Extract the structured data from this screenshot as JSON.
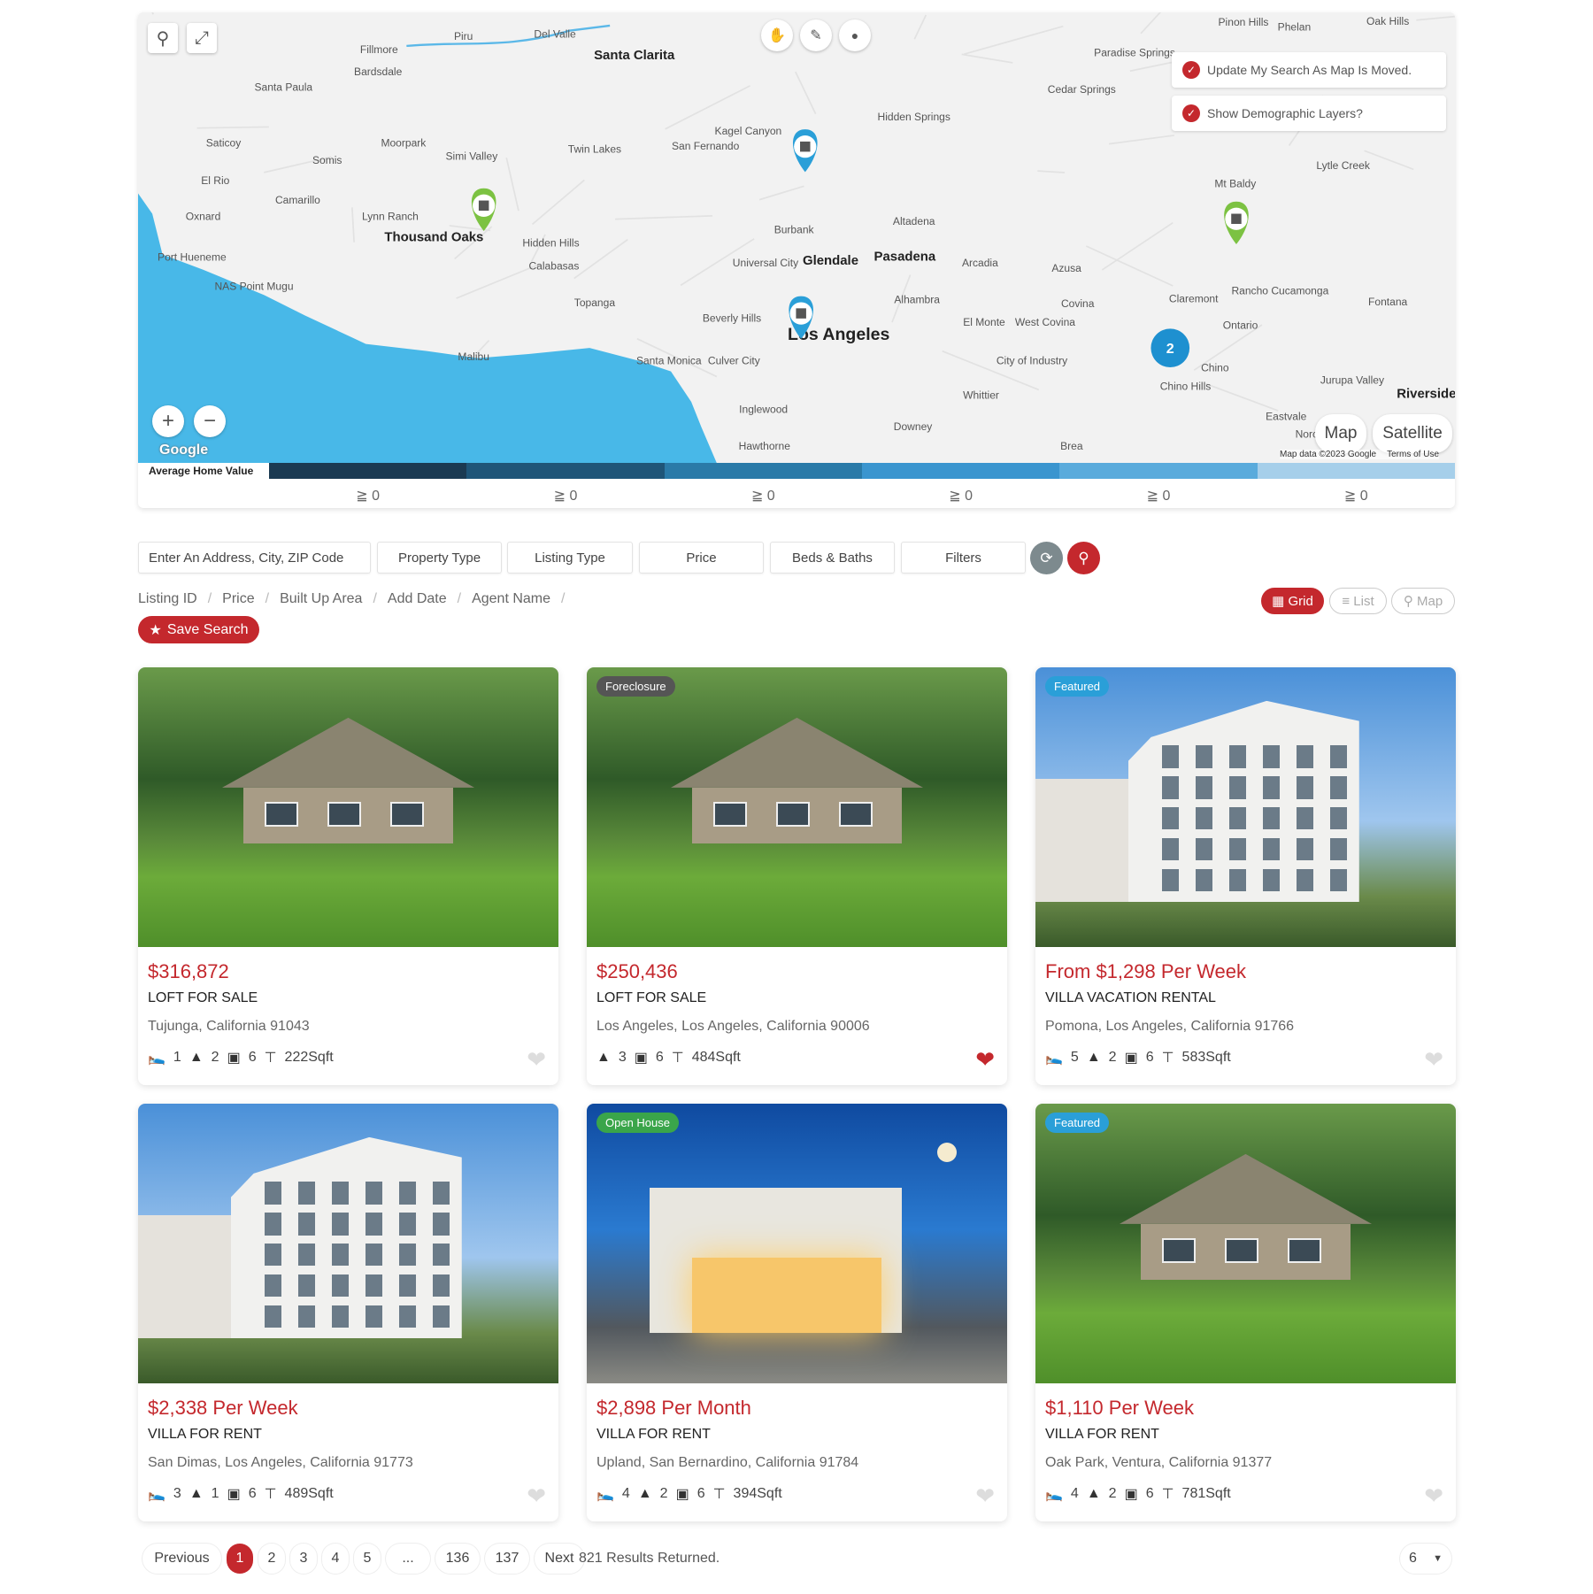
{
  "map": {
    "labels": [
      "Santa Clarita",
      "Thousand Oaks",
      "Glendale",
      "Pasadena",
      "Los Angeles",
      "Santa Monica",
      "Culver City",
      "Beverly Hills",
      "Burbank",
      "Malibu",
      "Topanga",
      "Calabasas",
      "Hidden Hills",
      "Simi Valley",
      "Moorpark",
      "Camarillo",
      "Oxnard",
      "Port Hueneme",
      "Somis",
      "Fillmore",
      "Santa Paula",
      "Piru",
      "Del Valle",
      "Twin Lakes",
      "San Fernando",
      "Kagel Canyon",
      "Altadena",
      "Arcadia",
      "Azusa",
      "Covina",
      "West Covina",
      "El Monte",
      "Alhambra",
      "Whittier",
      "Inglewood",
      "Hawthorne",
      "Downey",
      "Brea",
      "Claremont",
      "Ontario",
      "Rancho Cucamonga",
      "Fontana",
      "Chino",
      "Chino Hills",
      "Jurupa Valley",
      "Riverside",
      "Eastvale",
      "Mt Baldy",
      "Lytle Creek",
      "Cedar Springs",
      "Paradise Springs",
      "Pinon Hills",
      "Phelan",
      "Oak Hills",
      "Hidden Springs",
      "City of Industry",
      "Universal City",
      "Lynn Ranch",
      "Saticoy",
      "El Rio",
      "NAS Point Mugu",
      "Bardsdale",
      "Norco"
    ],
    "cluster_count": "2",
    "update_search_label": "Update My Search As Map Is Moved.",
    "demographic_label": "Show Demographic Layers?",
    "map_type_map": "Map",
    "map_type_satellite": "Satellite",
    "google_logo": "Google",
    "attribution": "Map data ©2023 Google",
    "terms": "Terms of Use",
    "zoom_in": "+",
    "zoom_out": "−",
    "ocean_color": "#48b8e8",
    "land_color": "#f2f2f2"
  },
  "legend": {
    "title": "Average Home Value",
    "colors": [
      "#1b3a52",
      "#1f5578",
      "#2a7aa8",
      "#3a95cf",
      "#5aabdc",
      "#a6cfea"
    ],
    "values": [
      "≧ 0",
      "≧ 0",
      "≧ 0",
      "≧ 0",
      "≧ 0",
      "≧ 0"
    ]
  },
  "filters": {
    "address_placeholder": "Enter An Address, City, ZIP Code",
    "property_type": "Property Type",
    "listing_type": "Listing Type",
    "price": "Price",
    "beds_baths": "Beds & Baths",
    "filters": "Filters"
  },
  "sort": [
    "Listing ID",
    "Price",
    "Built Up Area",
    "Add Date",
    "Agent Name"
  ],
  "views": {
    "grid": "Grid",
    "list": "List",
    "map": "Map",
    "active": "grid"
  },
  "save_search": "Save Search",
  "accent": "#c4282d",
  "listings": [
    {
      "image": "house",
      "badge": "",
      "price": "$316,872",
      "type": "LOFT FOR SALE",
      "address": "Tujunga, California 91043",
      "beds": "1",
      "baths": "2",
      "garage": "6",
      "area": "222Sqft",
      "favorite": false
    },
    {
      "image": "house",
      "badge": "Foreclosure",
      "badge_color": "#555555",
      "price": "$250,436",
      "type": "LOFT FOR SALE",
      "address": "Los Angeles, Los Angeles, California 90006",
      "baths": "3",
      "garage": "6",
      "area": "484Sqft",
      "favorite": true
    },
    {
      "image": "building",
      "badge": "Featured",
      "badge_color": "#2a9fd8",
      "price": "From $1,298 Per Week",
      "type": "VILLA VACATION RENTAL",
      "address": "Pomona, Los Angeles, California 91766",
      "beds": "5",
      "baths": "2",
      "garage": "6",
      "area": "583Sqft",
      "favorite": false
    },
    {
      "image": "building",
      "badge": "",
      "price": "$2,338 Per Week",
      "type": "VILLA FOR RENT",
      "address": "San Dimas, Los Angeles, California 91773",
      "beds": "3",
      "baths": "1",
      "garage": "6",
      "area": "489Sqft",
      "favorite": false
    },
    {
      "image": "night",
      "badge": "Open House",
      "badge_color": "#3aa54a",
      "price": "$2,898 Per Month",
      "type": "VILLA FOR RENT",
      "address": "Upland, San Bernardino, California 91784",
      "beds": "4",
      "baths": "2",
      "garage": "6",
      "area": "394Sqft",
      "favorite": false
    },
    {
      "image": "house",
      "badge": "Featured",
      "badge_color": "#2a9fd8",
      "price": "$1,110 Per Week",
      "type": "VILLA FOR RENT",
      "address": "Oak Park, Ventura, California 91377",
      "beds": "4",
      "baths": "2",
      "garage": "6",
      "area": "781Sqft",
      "favorite": false
    }
  ],
  "pagination": {
    "previous": "Previous",
    "pages": [
      "1",
      "2",
      "3",
      "4",
      "5",
      "...",
      "136",
      "137"
    ],
    "current": "1",
    "next": "Next",
    "results": "821 Results Returned.",
    "per_page": "6"
  }
}
